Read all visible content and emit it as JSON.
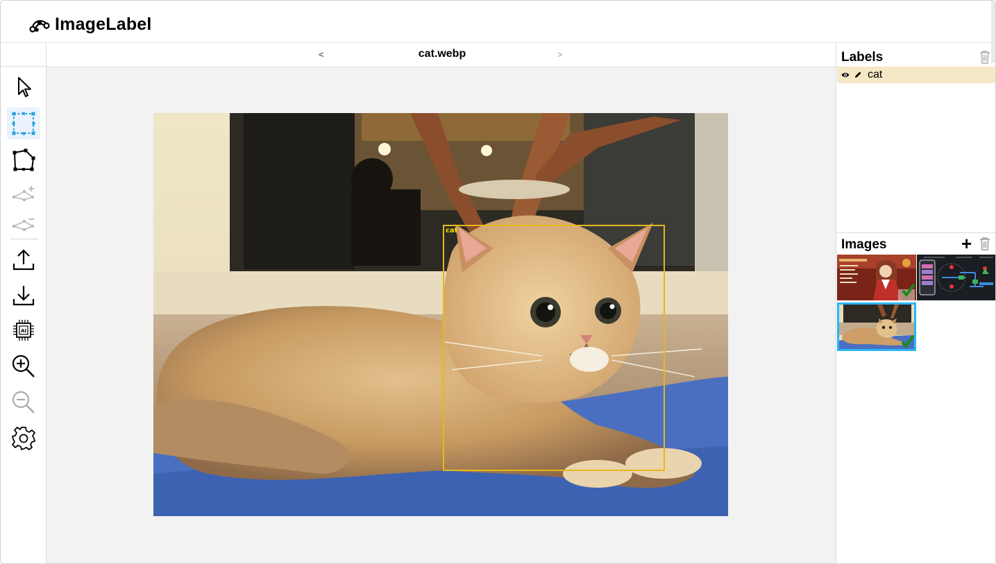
{
  "app": {
    "name": "ImageLabel",
    "logo_icon": "nodes-logo-icon"
  },
  "toolbar": {
    "tools": [
      {
        "name": "select",
        "icon": "cursor-icon",
        "enabled": true
      },
      {
        "name": "rectangle",
        "icon": "rectangle-tool-icon",
        "enabled": true,
        "active": true
      },
      {
        "name": "polygon",
        "icon": "polygon-tool-icon",
        "enabled": true
      },
      {
        "name": "add-point",
        "icon": "add-point-icon",
        "enabled": false
      },
      {
        "name": "remove-point",
        "icon": "remove-point-icon",
        "enabled": false
      },
      {
        "name": "upload",
        "icon": "upload-icon",
        "enabled": true
      },
      {
        "name": "download",
        "icon": "download-icon",
        "enabled": true
      },
      {
        "name": "ai-annotate",
        "icon": "ai-chip-icon",
        "enabled": true
      },
      {
        "name": "zoom-in",
        "icon": "zoom-in-icon",
        "enabled": true
      },
      {
        "name": "zoom-out",
        "icon": "zoom-out-icon",
        "enabled": false
      },
      {
        "name": "settings",
        "icon": "gear-icon",
        "enabled": true
      }
    ]
  },
  "filebar": {
    "prev": "<",
    "next": ">",
    "title": "cat.webp"
  },
  "canvas": {
    "annotation": {
      "label": "cat",
      "color": "#e6b81a",
      "label_color": "#f3e400"
    }
  },
  "labels_panel": {
    "title": "Labels",
    "items": [
      {
        "name": "cat",
        "visible": true,
        "editable": true,
        "highlight": "#f5e8c6"
      }
    ]
  },
  "images_panel": {
    "title": "Images",
    "add_label": "+",
    "thumbnails": [
      {
        "name": "anime-girl",
        "annotated": true,
        "selected": false
      },
      {
        "name": "diagram",
        "annotated": false,
        "selected": false
      },
      {
        "name": "cat",
        "annotated": true,
        "selected": true
      }
    ]
  },
  "colors": {
    "accent": "#29b6f6",
    "check": "#1a8a1a"
  }
}
